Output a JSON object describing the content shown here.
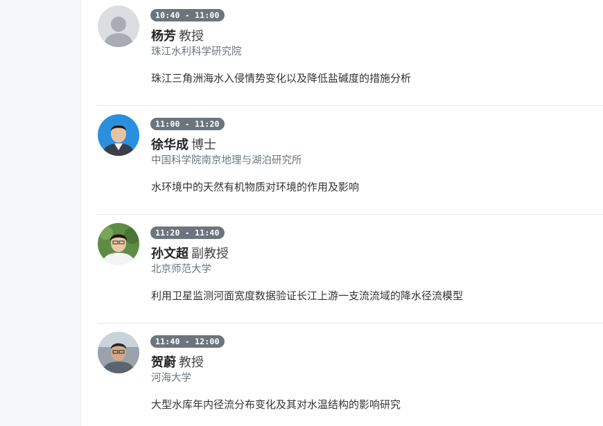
{
  "talks": [
    {
      "time": "10:40 - 11:00",
      "name": "杨芳",
      "rank": "教授",
      "affiliation": "珠江水利科学研究院",
      "topic": "珠江三角洲海水入侵情势变化以及降低盐碱度的措施分析",
      "avatar": "default-avatar-placeholder"
    },
    {
      "time": "11:00 - 11:20",
      "name": "徐华成",
      "rank": "博士",
      "affiliation": "中国科学院南京地理与湖泊研究所",
      "topic": "水环境中的天然有机物质对环境的作用及影响",
      "avatar": "portrait-photo"
    },
    {
      "time": "11:20 - 11:40",
      "name": "孙文超",
      "rank": "副教授",
      "affiliation": "北京师范大学",
      "topic": "利用卫星监测河面宽度数据验证长江上游一支流流域的降水径流模型",
      "avatar": "portrait-photo"
    },
    {
      "time": "11:40 - 12:00",
      "name": "贺蔚",
      "rank": "教授",
      "affiliation": "河海大学",
      "topic": "大型水库年内径流分布变化及其对水温结构的影响研究",
      "avatar": "portrait-photo"
    }
  ],
  "colors": {
    "badge": "#6c757d",
    "affiliation": "#6c757d",
    "divider": "#e5e7ea",
    "rail": "#f5f6f8"
  }
}
